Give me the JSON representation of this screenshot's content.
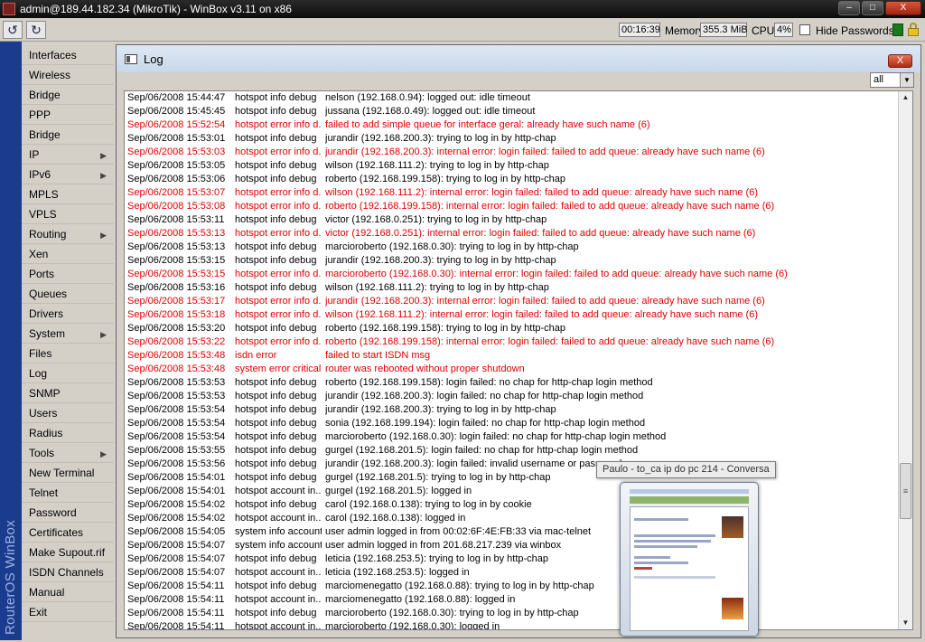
{
  "window": {
    "title": "admin@189.44.182.34 (MikroTik) - WinBox v3.11 on x86",
    "minimize": "–",
    "maximize": "□",
    "close": "X"
  },
  "toolbar": {
    "undo_icon": "↺",
    "redo_icon": "↻",
    "uptime": "00:16:39",
    "memory_label": "Memory:",
    "memory_value": "355.3 MiB",
    "cpu_label": "CPU:",
    "cpu_value": "4%",
    "hide_passwords_label": "Hide Passwords",
    "hide_passwords_checked": false,
    "status_color": "#187a1d"
  },
  "brand": "RouterOS WinBox",
  "sidebar": {
    "items": [
      {
        "label": "Interfaces",
        "submenu": false
      },
      {
        "label": "Wireless",
        "submenu": false
      },
      {
        "label": "Bridge",
        "submenu": false
      },
      {
        "label": "PPP",
        "submenu": false
      },
      {
        "label": "Bridge",
        "submenu": false
      },
      {
        "label": "IP",
        "submenu": true
      },
      {
        "label": "IPv6",
        "submenu": true
      },
      {
        "label": "MPLS",
        "submenu": false
      },
      {
        "label": "VPLS",
        "submenu": false
      },
      {
        "label": "Routing",
        "submenu": true
      },
      {
        "label": "Xen",
        "submenu": false
      },
      {
        "label": "Ports",
        "submenu": false
      },
      {
        "label": "Queues",
        "submenu": false
      },
      {
        "label": "Drivers",
        "submenu": false
      },
      {
        "label": "System",
        "submenu": true
      },
      {
        "label": "Files",
        "submenu": false
      },
      {
        "label": "Log",
        "submenu": false
      },
      {
        "label": "SNMP",
        "submenu": false
      },
      {
        "label": "Users",
        "submenu": false
      },
      {
        "label": "Radius",
        "submenu": false
      },
      {
        "label": "Tools",
        "submenu": true
      },
      {
        "label": "New Terminal",
        "submenu": false
      },
      {
        "label": "Telnet",
        "submenu": false
      },
      {
        "label": "Password",
        "submenu": false
      },
      {
        "label": "Certificates",
        "submenu": false
      },
      {
        "label": "Make Supout.rif",
        "submenu": false
      },
      {
        "label": "ISDN Channels",
        "submenu": false
      },
      {
        "label": "Manual",
        "submenu": false
      },
      {
        "label": "Exit",
        "submenu": false
      }
    ],
    "submenu_arrow": "▶"
  },
  "log": {
    "title": "Log",
    "close_label": "X",
    "filter_value": "all",
    "filter_dropdown_icon": "▼",
    "error_color": "#e00000",
    "rows": [
      {
        "time": "Sep/06/2008 15:44:47",
        "topics": "hotspot info debug",
        "message": "nelson (192.168.0.94): logged out: idle timeout",
        "error": false
      },
      {
        "time": "Sep/06/2008 15:45:45",
        "topics": "hotspot info debug",
        "message": "jussana (192.168.0.49): logged out: idle timeout",
        "error": false
      },
      {
        "time": "Sep/06/2008 15:52:54",
        "topics": "hotspot error info d...",
        "message": "failed to add simple queue for interface geral: already have such name (6)",
        "error": true
      },
      {
        "time": "Sep/06/2008 15:53:01",
        "topics": "hotspot info debug",
        "message": "jurandir (192.168.200.3): trying to log in by http-chap",
        "error": false
      },
      {
        "time": "Sep/06/2008 15:53:03",
        "topics": "hotspot error info d...",
        "message": "jurandir (192.168.200.3): internal error: login failed: failed to add queue: already have such name (6)",
        "error": true
      },
      {
        "time": "Sep/06/2008 15:53:05",
        "topics": "hotspot info debug",
        "message": "wilson (192.168.111.2): trying to log in by http-chap",
        "error": false
      },
      {
        "time": "Sep/06/2008 15:53:06",
        "topics": "hotspot info debug",
        "message": "roberto (192.168.199.158): trying to log in by http-chap",
        "error": false
      },
      {
        "time": "Sep/06/2008 15:53:07",
        "topics": "hotspot error info d...",
        "message": "wilson (192.168.111.2): internal error: login failed: failed to add queue: already have such name (6)",
        "error": true
      },
      {
        "time": "Sep/06/2008 15:53:08",
        "topics": "hotspot error info d...",
        "message": "roberto (192.168.199.158): internal error: login failed: failed to add queue: already have such name (6)",
        "error": true
      },
      {
        "time": "Sep/06/2008 15:53:11",
        "topics": "hotspot info debug",
        "message": "victor (192.168.0.251): trying to log in by http-chap",
        "error": false
      },
      {
        "time": "Sep/06/2008 15:53:13",
        "topics": "hotspot error info d...",
        "message": "victor (192.168.0.251): internal error: login failed: failed to add queue: already have such name (6)",
        "error": true
      },
      {
        "time": "Sep/06/2008 15:53:13",
        "topics": "hotspot info debug",
        "message": "marcioroberto (192.168.0.30): trying to log in by http-chap",
        "error": false
      },
      {
        "time": "Sep/06/2008 15:53:15",
        "topics": "hotspot info debug",
        "message": "jurandir (192.168.200.3): trying to log in by http-chap",
        "error": false
      },
      {
        "time": "Sep/06/2008 15:53:15",
        "topics": "hotspot error info d...",
        "message": "marcioroberto (192.168.0.30): internal error: login failed: failed to add queue: already have such name (6)",
        "error": true
      },
      {
        "time": "Sep/06/2008 15:53:16",
        "topics": "hotspot info debug",
        "message": "wilson (192.168.111.2): trying to log in by http-chap",
        "error": false
      },
      {
        "time": "Sep/06/2008 15:53:17",
        "topics": "hotspot error info d...",
        "message": "jurandir (192.168.200.3): internal error: login failed: failed to add queue: already have such name (6)",
        "error": true
      },
      {
        "time": "Sep/06/2008 15:53:18",
        "topics": "hotspot error info d...",
        "message": "wilson (192.168.111.2): internal error: login failed: failed to add queue: already have such name (6)",
        "error": true
      },
      {
        "time": "Sep/06/2008 15:53:20",
        "topics": "hotspot info debug",
        "message": "roberto (192.168.199.158): trying to log in by http-chap",
        "error": false
      },
      {
        "time": "Sep/06/2008 15:53:22",
        "topics": "hotspot error info d...",
        "message": "roberto (192.168.199.158): internal error: login failed: failed to add queue: already have such name (6)",
        "error": true
      },
      {
        "time": "Sep/06/2008 15:53:48",
        "topics": "isdn error",
        "message": "failed to start ISDN msg",
        "error": true
      },
      {
        "time": "Sep/06/2008 15:53:48",
        "topics": "system error critical",
        "message": "router was rebooted without proper shutdown",
        "error": true
      },
      {
        "time": "Sep/06/2008 15:53:53",
        "topics": "hotspot info debug",
        "message": "roberto (192.168.199.158): login failed: no chap for http-chap login method",
        "error": false
      },
      {
        "time": "Sep/06/2008 15:53:53",
        "topics": "hotspot info debug",
        "message": "jurandir (192.168.200.3): login failed: no chap for http-chap login method",
        "error": false
      },
      {
        "time": "Sep/06/2008 15:53:54",
        "topics": "hotspot info debug",
        "message": "jurandir (192.168.200.3): trying to log in by http-chap",
        "error": false
      },
      {
        "time": "Sep/06/2008 15:53:54",
        "topics": "hotspot info debug",
        "message": "sonia (192.168.199.194): login failed: no chap for http-chap login method",
        "error": false
      },
      {
        "time": "Sep/06/2008 15:53:54",
        "topics": "hotspot info debug",
        "message": "marcioroberto (192.168.0.30): login failed: no chap for http-chap login method",
        "error": false
      },
      {
        "time": "Sep/06/2008 15:53:55",
        "topics": "hotspot info debug",
        "message": "gurgel (192.168.201.5): login failed: no chap for http-chap login method",
        "error": false
      },
      {
        "time": "Sep/06/2008 15:53:56",
        "topics": "hotspot info debug",
        "message": "jurandir (192.168.200.3): login failed: invalid username or password",
        "error": false
      },
      {
        "time": "Sep/06/2008 15:54:01",
        "topics": "hotspot info debug",
        "message": "gurgel (192.168.201.5): trying to log in by http-chap",
        "error": false
      },
      {
        "time": "Sep/06/2008 15:54:01",
        "topics": "hotspot account in...",
        "message": "gurgel (192.168.201.5): logged in",
        "error": false
      },
      {
        "time": "Sep/06/2008 15:54:02",
        "topics": "hotspot info debug",
        "message": "carol (192.168.0.138): trying to log in by cookie",
        "error": false
      },
      {
        "time": "Sep/06/2008 15:54:02",
        "topics": "hotspot account in...",
        "message": "carol (192.168.0.138): logged in",
        "error": false
      },
      {
        "time": "Sep/06/2008 15:54:05",
        "topics": "system info account",
        "message": "user admin logged in from 00:02:6F:4E:FB:33 via mac-telnet",
        "error": false
      },
      {
        "time": "Sep/06/2008 15:54:07",
        "topics": "system info account",
        "message": "user admin logged in from 201.68.217.239 via winbox",
        "error": false
      },
      {
        "time": "Sep/06/2008 15:54:07",
        "topics": "hotspot info debug",
        "message": "leticia (192.168.253.5): trying to log in by http-chap",
        "error": false
      },
      {
        "time": "Sep/06/2008 15:54:07",
        "topics": "hotspot account in...",
        "message": "leticia (192.168.253.5): logged in",
        "error": false
      },
      {
        "time": "Sep/06/2008 15:54:11",
        "topics": "hotspot info debug",
        "message": "marciomenegatto (192.168.0.88): trying to log in by http-chap",
        "error": false
      },
      {
        "time": "Sep/06/2008 15:54:11",
        "topics": "hotspot account in...",
        "message": "marciomenegatto (192.168.0.88): logged in",
        "error": false
      },
      {
        "time": "Sep/06/2008 15:54:11",
        "topics": "hotspot info debug",
        "message": "marcioroberto (192.168.0.30): trying to log in by http-chap",
        "error": false
      },
      {
        "time": "Sep/06/2008 15:54:11",
        "topics": "hotspot account in...",
        "message": "marcioroberto (192.168.0.30): logged in",
        "error": false
      }
    ],
    "scroll_up_icon": "▲",
    "scroll_down_icon": "▼",
    "scroll_grip": "≡"
  },
  "taskbar_tooltip": "Paulo - to_ca ip do pc 214 - Conversa"
}
